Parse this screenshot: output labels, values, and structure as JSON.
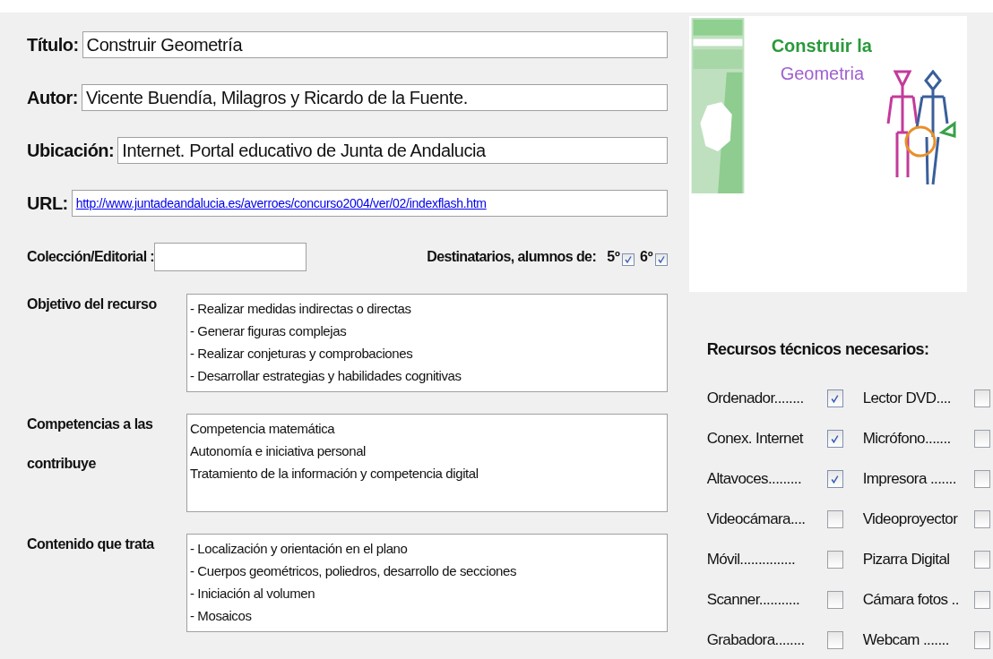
{
  "fields": [
    {
      "label": "Título:",
      "value": "Construir Geometría",
      "kind": "text"
    },
    {
      "label": "Autor:",
      "value": "Vicente Buendía, Milagros y Ricardo de la Fuente.",
      "kind": "text"
    },
    {
      "label": "Ubicación:",
      "value": "Internet. Portal educativo de Junta de Andalucia",
      "kind": "text"
    },
    {
      "label": "URL:",
      "value": "http://www.juntadeandalucia.es/averroes/concurso2004/ver/02/indexflash.htm",
      "kind": "link"
    }
  ],
  "coleccion": {
    "label": "Colección/Editorial :"
  },
  "destinatarios": {
    "label": "Destinatarios, alumnos de:",
    "grades": [
      {
        "label": "5º",
        "checked": true
      },
      {
        "label": "6º",
        "checked": true
      }
    ]
  },
  "areas": [
    {
      "label": "Objetivo del recurso",
      "lines": [
        "- Realizar medidas indirectas o directas",
        "- Generar figuras complejas",
        "- Realizar conjeturas y comprobaciones",
        "- Desarrollar estrategias y habilidades cognitivas"
      ]
    },
    {
      "label": "Competencias a las contribuye",
      "lines": [
        "Competencia matemática",
        "Autonomía e iniciativa personal",
        "Tratamiento de la información y competencia digital"
      ]
    },
    {
      "label": "Contenido que trata",
      "lines": [
        "- Localización y orientación en el plano",
        "- Cuerpos geométricos, poliedros, desarrollo de secciones",
        "- Iniciación al volumen",
        "- Mosaicos"
      ]
    }
  ],
  "thumbnail": {
    "title_line_1": "Construir la",
    "title_line_2": "Geometria"
  },
  "resources": {
    "title": "Recursos técnicos necesarios:",
    "items": [
      {
        "label": "Ordenador........",
        "checked": true
      },
      {
        "label": "Lector DVD....",
        "checked": false
      },
      {
        "label": "Conex. Internet",
        "checked": true
      },
      {
        "label": "Micrófono.......",
        "checked": false
      },
      {
        "label": "Altavoces.........",
        "checked": true
      },
      {
        "label": "Impresora .......",
        "checked": false
      },
      {
        "label": "Videocámara....",
        "checked": false
      },
      {
        "label": "Videoproyector",
        "checked": false
      },
      {
        "label": "Móvil...............",
        "checked": false
      },
      {
        "label": "Pizarra Digital",
        "checked": false
      },
      {
        "label": "Scanner...........",
        "checked": false
      },
      {
        "label": "Cámara fotos ..",
        "checked": false
      },
      {
        "label": "Grabadora........",
        "checked": false
      },
      {
        "label": "Webcam .......",
        "checked": false
      }
    ]
  }
}
